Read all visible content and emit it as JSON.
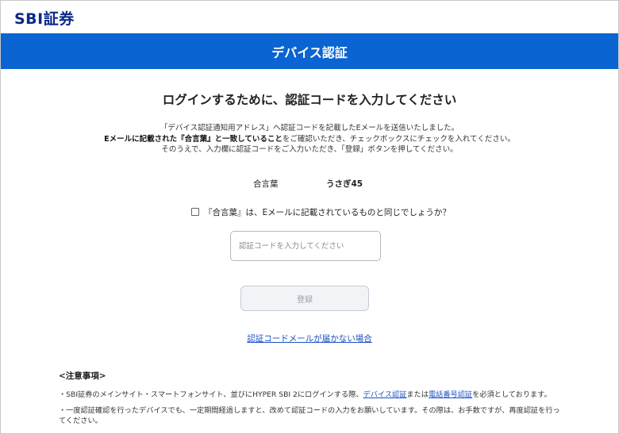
{
  "header": {
    "logo_text": "SBI証券"
  },
  "banner": {
    "title": "デバイス認証"
  },
  "main": {
    "heading": "ログインするために、認証コードを入力してください",
    "intro_line1": "「デバイス認証通知用アドレス」へ認証コードを記載したEメールを送信いたしました。",
    "intro_line2_bold": "Eメールに記載された『合言葉』と一致していること",
    "intro_line2_rest": "をご確認いただき、チェックボックスにチェックを入れてください。",
    "intro_line3": "そのうえで、入力欄に認証コードをご入力いただき、「登録」ボタンを押してください。",
    "keyword_label": "合言葉",
    "keyword_value": "うさぎ45",
    "checkbox_label": "『合言葉』は、Eメールに記載されているものと同じでしょうか？",
    "code_input_placeholder": "認証コードを入力してください",
    "code_input_value": "",
    "submit_label": "登録",
    "help_link": "認証コードメールが届かない場合"
  },
  "notes": {
    "title": "<注意事項>",
    "line1_pre": "・SBI証券のメインサイト・スマートフォンサイト、並びにHYPER SBI 2にログインする際、",
    "line1_link1": "デバイス認証",
    "line1_mid": "または",
    "line1_link2": "電話番号認証",
    "line1_post": "を必須としております。",
    "line2": "・一度認証確認を行ったデバイスでも、一定期間経過しますと、改めて認証コードの入力をお願いしています。その際は、お手数ですが、再度認証を行ってください。"
  }
}
